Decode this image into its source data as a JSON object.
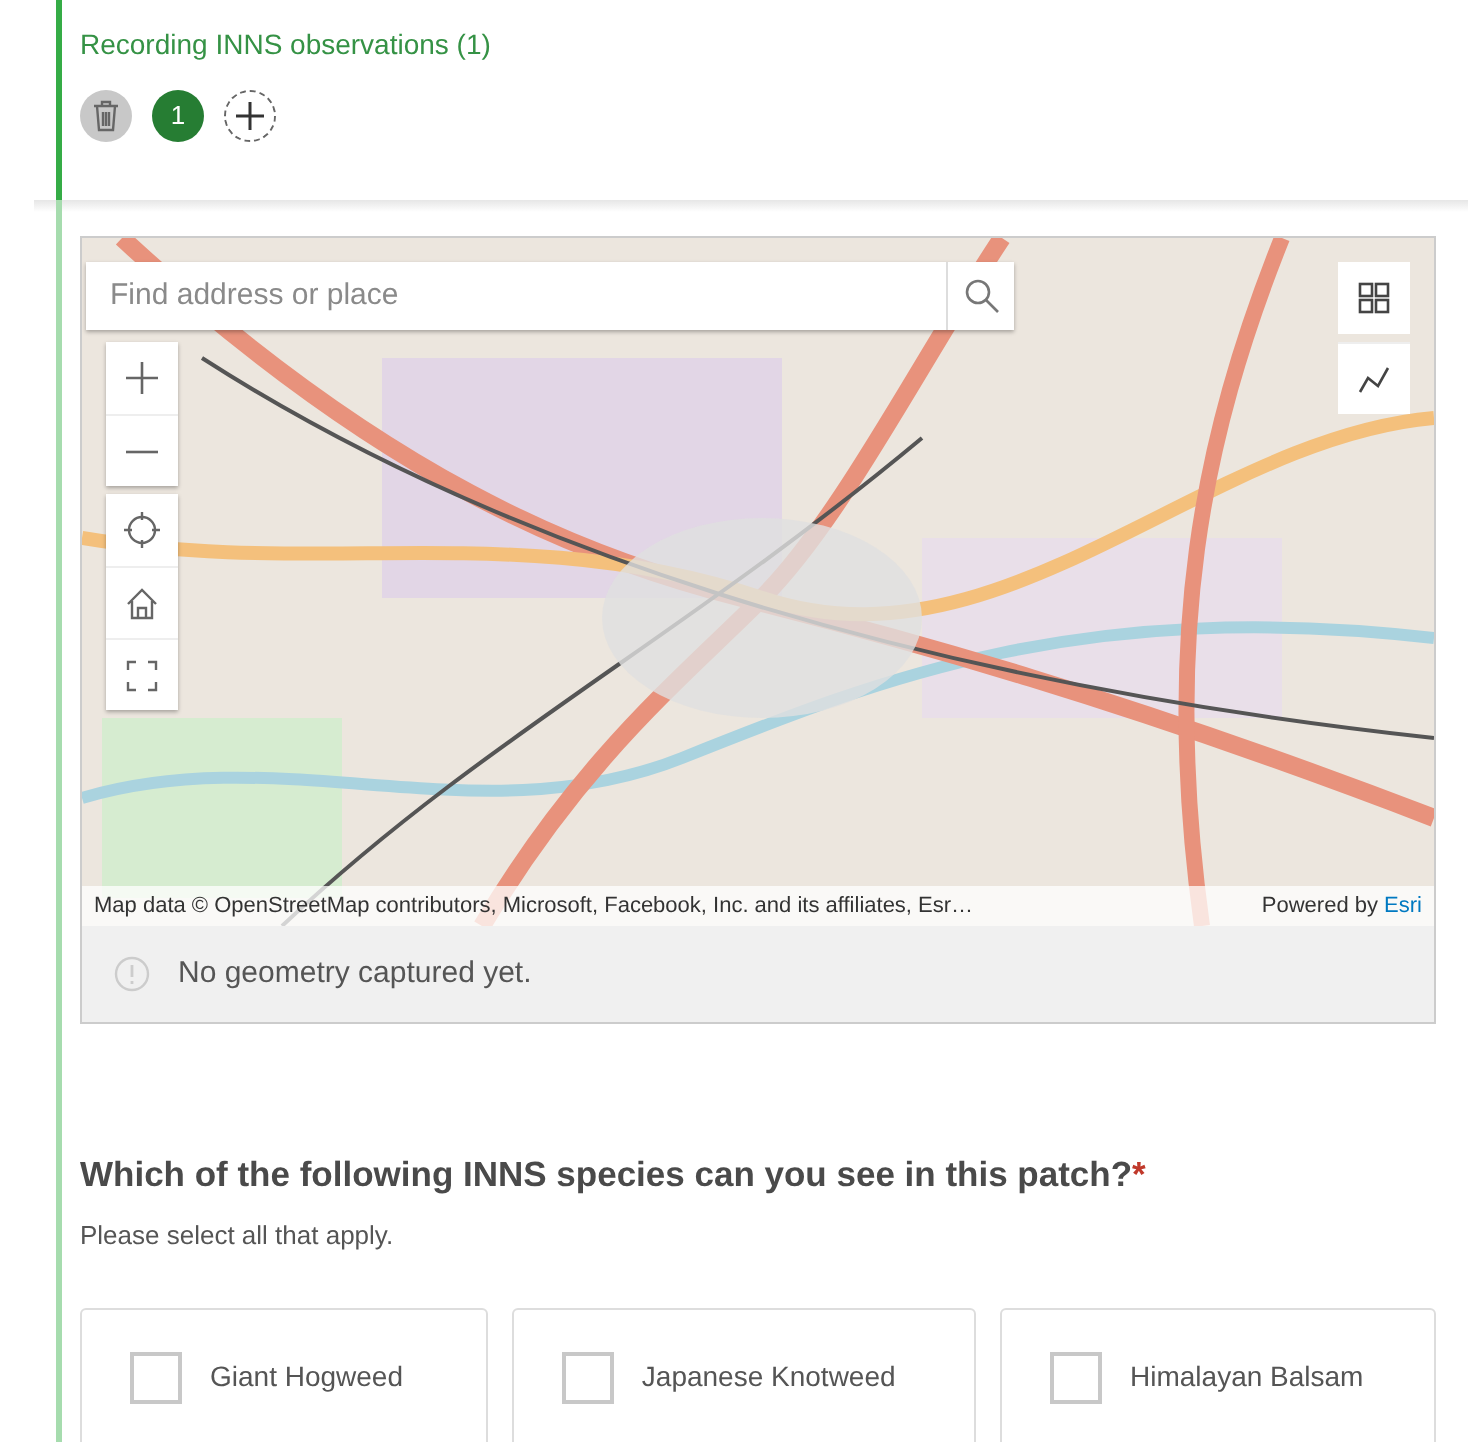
{
  "repeat": {
    "title": "Recording INNS observations (1)",
    "pages": [
      {
        "label": "1",
        "selected": true
      }
    ]
  },
  "map": {
    "search": {
      "placeholder": "Find address or place"
    },
    "attribution": "Map data © OpenStreetMap contributors, Microsoft, Facebook, Inc. and its affiliates, Esr…",
    "powered_by": "Powered by",
    "powered_link": "Esri",
    "status": "No geometry captured yet."
  },
  "question": {
    "label": "Which of the following INNS species can you see in this patch?",
    "required_mark": "*",
    "hint": "Please select all that apply.",
    "options": [
      {
        "label": "Giant Hogweed",
        "checked": false
      },
      {
        "label": "Japanese Knotweed",
        "checked": false
      },
      {
        "label": "Himalayan Balsam",
        "checked": false
      }
    ]
  }
}
